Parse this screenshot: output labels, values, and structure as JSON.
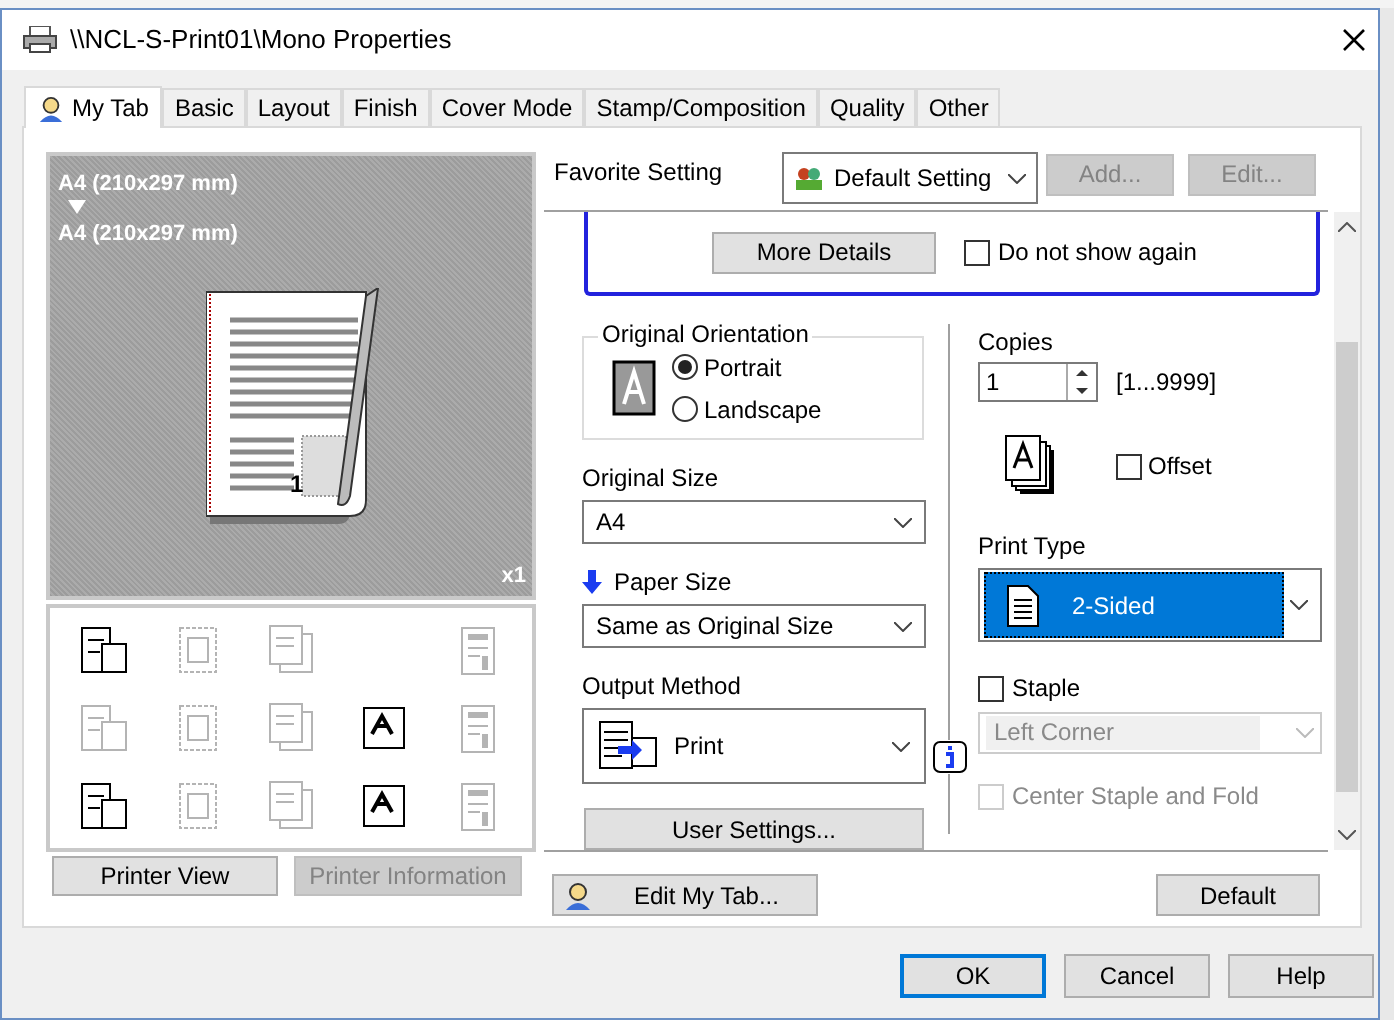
{
  "window": {
    "title": "\\\\NCL-S-Print01\\Mono Properties"
  },
  "tabs": [
    {
      "label": "My Tab",
      "selected": true
    },
    {
      "label": "Basic",
      "selected": false
    },
    {
      "label": "Layout",
      "selected": false
    },
    {
      "label": "Finish",
      "selected": false
    },
    {
      "label": "Cover Mode",
      "selected": false
    },
    {
      "label": "Stamp/Composition",
      "selected": false
    },
    {
      "label": "Quality",
      "selected": false
    },
    {
      "label": "Other",
      "selected": false
    }
  ],
  "preview": {
    "original_size": "A4 (210x297 mm)",
    "paper_size": "A4 (210x297 mm)",
    "page_number": "1",
    "copies_badge": "x1"
  },
  "function_icons": [
    {
      "kind": "icon",
      "disabled": false
    },
    {
      "kind": "icon",
      "disabled": true
    },
    {
      "kind": "icon",
      "disabled": true
    },
    {
      "kind": "empty"
    },
    {
      "kind": "icon",
      "disabled": true
    },
    {
      "kind": "icon",
      "disabled": true
    },
    {
      "kind": "icon",
      "disabled": true
    },
    {
      "kind": "icon",
      "disabled": true
    },
    {
      "kind": "icon",
      "disabled": false
    },
    {
      "kind": "icon",
      "disabled": true
    },
    {
      "kind": "icon",
      "disabled": false
    },
    {
      "kind": "icon",
      "disabled": true
    },
    {
      "kind": "icon",
      "disabled": true
    },
    {
      "kind": "icon",
      "disabled": false
    },
    {
      "kind": "icon",
      "disabled": true
    }
  ],
  "left_buttons": [
    {
      "label": "Printer View",
      "disabled": false
    },
    {
      "label": "Printer Information",
      "disabled": true
    }
  ],
  "favorite": {
    "label": "Favorite Setting",
    "value": "Default Setting",
    "buttons": [
      {
        "label": "Add...",
        "disabled": true
      },
      {
        "label": "Edit...",
        "disabled": true
      }
    ]
  },
  "notice": {
    "button": "More Details",
    "checkbox": {
      "label": "Do not show again",
      "checked": false
    }
  },
  "orientation": {
    "label": "Original Orientation",
    "options": [
      {
        "label": "Portrait",
        "selected": true
      },
      {
        "label": "Landscape",
        "selected": false
      }
    ]
  },
  "original_size": {
    "label": "Original Size",
    "value": "A4"
  },
  "paper_size": {
    "label": "Paper Size",
    "value": "Same as Original Size"
  },
  "output_method": {
    "label": "Output Method",
    "value": "Print"
  },
  "user_settings": "User Settings...",
  "copies": {
    "label": "Copies",
    "value": "1",
    "range": "[1...9999]"
  },
  "offset": {
    "label": "Offset",
    "checked": false
  },
  "print_type": {
    "label": "Print Type",
    "value": "2-Sided"
  },
  "staple": {
    "label": "Staple",
    "checked": false,
    "position": "Left Corner",
    "position_disabled": true
  },
  "center_staple": {
    "label": "Center Staple and Fold",
    "checked": false,
    "disabled": true
  },
  "edit_my_tab": "Edit My Tab...",
  "default_button": "Default",
  "dialog_buttons": [
    {
      "label": "OK",
      "default": true
    },
    {
      "label": "Cancel",
      "default": false
    },
    {
      "label": "Help",
      "default": false
    }
  ]
}
